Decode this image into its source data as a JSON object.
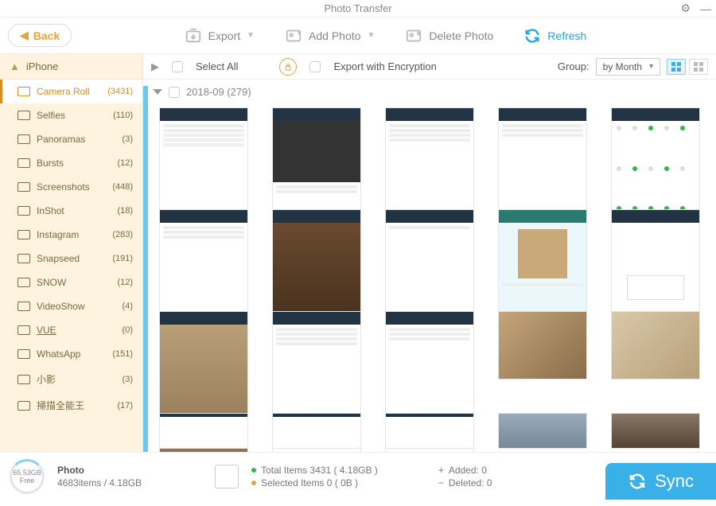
{
  "titlebar": {
    "title": "Photo Transfer"
  },
  "toolbar": {
    "back": "Back",
    "export": "Export",
    "add_photo": "Add Photo",
    "delete_photo": "Delete Photo",
    "refresh": "Refresh"
  },
  "sidebar": {
    "device": "iPhone",
    "items": [
      {
        "label": "Camera Roll",
        "count": "(3431)",
        "active": true
      },
      {
        "label": "Selfies",
        "count": "(110)"
      },
      {
        "label": "Panoramas",
        "count": "(3)"
      },
      {
        "label": "Bursts",
        "count": "(12)"
      },
      {
        "label": "Screenshots",
        "count": "(448)"
      },
      {
        "label": "InShot",
        "count": "(18)"
      },
      {
        "label": "Instagram",
        "count": "(283)"
      },
      {
        "label": "Snapseed",
        "count": "(191)"
      },
      {
        "label": "SNOW",
        "count": "(12)"
      },
      {
        "label": "VideoShow",
        "count": "(4)"
      },
      {
        "label": "VUE",
        "count": "(0)",
        "underline": true
      },
      {
        "label": "WhatsApp",
        "count": "(151)"
      },
      {
        "label": "小影",
        "count": "(3)"
      },
      {
        "label": "掃描全能王",
        "count": "(17)"
      }
    ]
  },
  "content_top": {
    "select_all": "Select All",
    "export_encryption": "Export with Encryption",
    "group_label": "Group:",
    "group_value": "by Month"
  },
  "date_group": {
    "label": "2018-09 (279)"
  },
  "footer": {
    "storage_total": "65.53GB",
    "storage_free": "Free",
    "photo_label": "Photo",
    "photo_summary": "4683items / 4.18GB",
    "total_items": "Total Items 3431 ( 4.18GB )",
    "selected_items": "Selected Items 0 ( 0B )",
    "added": "Added: 0",
    "deleted": "Deleted: 0",
    "sync": "Sync"
  }
}
